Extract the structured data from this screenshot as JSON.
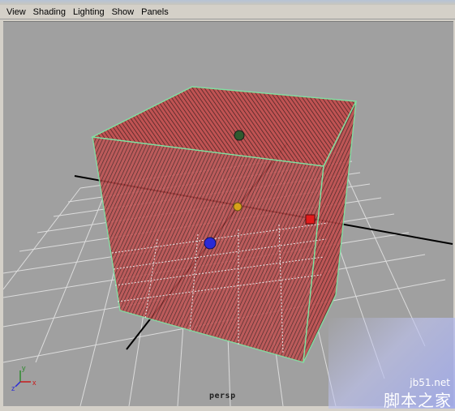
{
  "menu": {
    "items": [
      {
        "label": "View"
      },
      {
        "label": "Shading"
      },
      {
        "label": "Lighting"
      },
      {
        "label": "Show"
      },
      {
        "label": "Panels"
      }
    ]
  },
  "viewport": {
    "camera_label": "persp",
    "axis_indicator": {
      "x": "x",
      "y": "y",
      "z": "z"
    }
  },
  "watermark": {
    "site": "jb51.net",
    "chinese": "脚本之家"
  },
  "colors": {
    "viewport_bg": "#a0a0a0",
    "cube_fill": "#c24f4f",
    "cube_edge": "#7fe3a2",
    "grid": "#d9d9d9",
    "axis": "#000000",
    "manip_red": "#e11b1b",
    "manip_blue": "#2a2ad6",
    "manip_green": "#2f5a2f",
    "manip_yellow": "#d7a21a"
  }
}
